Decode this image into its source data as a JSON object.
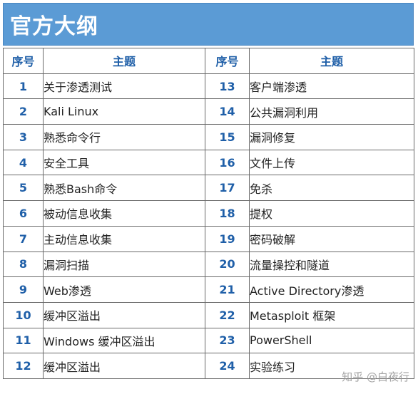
{
  "title": "官方大纲",
  "headers": {
    "num": "序号",
    "topic": "主题"
  },
  "rows": [
    {
      "left_num": "1",
      "left_topic": "关于渗透测试",
      "right_num": "13",
      "right_topic": "客户端渗透"
    },
    {
      "left_num": "2",
      "left_topic": "Kali Linux",
      "right_num": "14",
      "right_topic": "公共漏洞利用"
    },
    {
      "left_num": "3",
      "left_topic": "熟悉命令行",
      "right_num": "15",
      "right_topic": "漏洞修复"
    },
    {
      "left_num": "4",
      "left_topic": "安全工具",
      "right_num": "16",
      "right_topic": "文件上传"
    },
    {
      "left_num": "5",
      "left_topic": "熟悉Bash命令",
      "right_num": "17",
      "right_topic": "免杀"
    },
    {
      "left_num": "6",
      "left_topic": "被动信息收集",
      "right_num": "18",
      "right_topic": "提权"
    },
    {
      "left_num": "7",
      "left_topic": "主动信息收集",
      "right_num": "19",
      "right_topic": "密码破解"
    },
    {
      "left_num": "8",
      "left_topic": "漏洞扫描",
      "right_num": "20",
      "right_topic": "流量操控和隧道"
    },
    {
      "left_num": "9",
      "left_topic": "Web渗透",
      "right_num": "21",
      "right_topic": "Active Directory渗透"
    },
    {
      "left_num": "10",
      "left_topic": "缓冲区溢出",
      "right_num": "22",
      "right_topic": "Metasploit 框架"
    },
    {
      "left_num": "11",
      "left_topic": "Windows 缓冲区溢出",
      "right_num": "23",
      "right_topic": "PowerShell"
    },
    {
      "left_num": "12",
      "left_topic": "缓冲区溢出",
      "right_num": "24",
      "right_topic": "实验练习"
    }
  ],
  "watermark": "知乎 @白夜行",
  "colors": {
    "title_bg": "#5b9bd5",
    "accent_text": "#1f5fa8"
  }
}
